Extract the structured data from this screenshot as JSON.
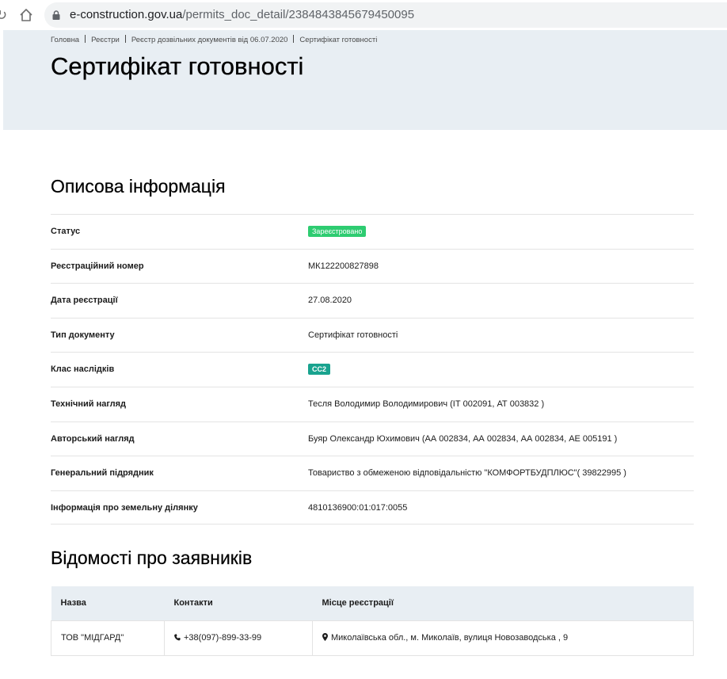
{
  "browser": {
    "url_host": "e-construction.gov.ua",
    "url_path": "/permits_doc_detail/2384843845679450095"
  },
  "breadcrumb": [
    "Головна",
    "Реєстри",
    "Реєстр дозвільних документів від 06.07.2020",
    "Сертифікат готовності"
  ],
  "page_title": "Сертифікат готовності",
  "description": {
    "title": "Описова інформація",
    "rows": [
      {
        "label": "Статус",
        "value": "Зареєстровано"
      },
      {
        "label": "Реєстраційний номер",
        "value": "МК122200827898"
      },
      {
        "label": "Дата реєстрації",
        "value": "27.08.2020"
      },
      {
        "label": "Тип документу",
        "value": "Сертифікат готовності"
      },
      {
        "label": "Клас наслідків",
        "value": "СС2"
      },
      {
        "label": "Технічний нагляд",
        "value": "Тесля Володимир Володимирович (ІТ 002091, АТ 003832 )"
      },
      {
        "label": "Авторський нагляд",
        "value": "Буяр Олександр Юхимович (АА 002834, АА 002834, АА 002834, АЕ 005191 )"
      },
      {
        "label": "Генеральний підрядник",
        "value": "Товариство з обмеженою відповідальністю \"КОМФОРТБУДПЛЮС\"( 39822995 )"
      },
      {
        "label": "Інформація про земельну ділянку",
        "value": "4810136900:01:017:0055"
      }
    ]
  },
  "applicants": {
    "title": "Відомості про заявників",
    "headers": [
      "Назва",
      "Контакти",
      "Місце реєстрації"
    ],
    "rows": [
      {
        "name": "ТОВ \"МІДГАРД\"",
        "phone": "+38(097)-899-33-99",
        "address": "Миколаївська обл., м. Миколаїв, вулиця Новозаводська , 9"
      }
    ]
  },
  "icons": {
    "reload": "reload-icon",
    "home": "home-icon",
    "lock": "lock-icon",
    "phone": "phone-icon",
    "location": "map-marker-icon"
  },
  "colors": {
    "hero_bg": "#e8eef3",
    "status_badge": "#2ecc71",
    "class_badge": "#19a38f"
  }
}
